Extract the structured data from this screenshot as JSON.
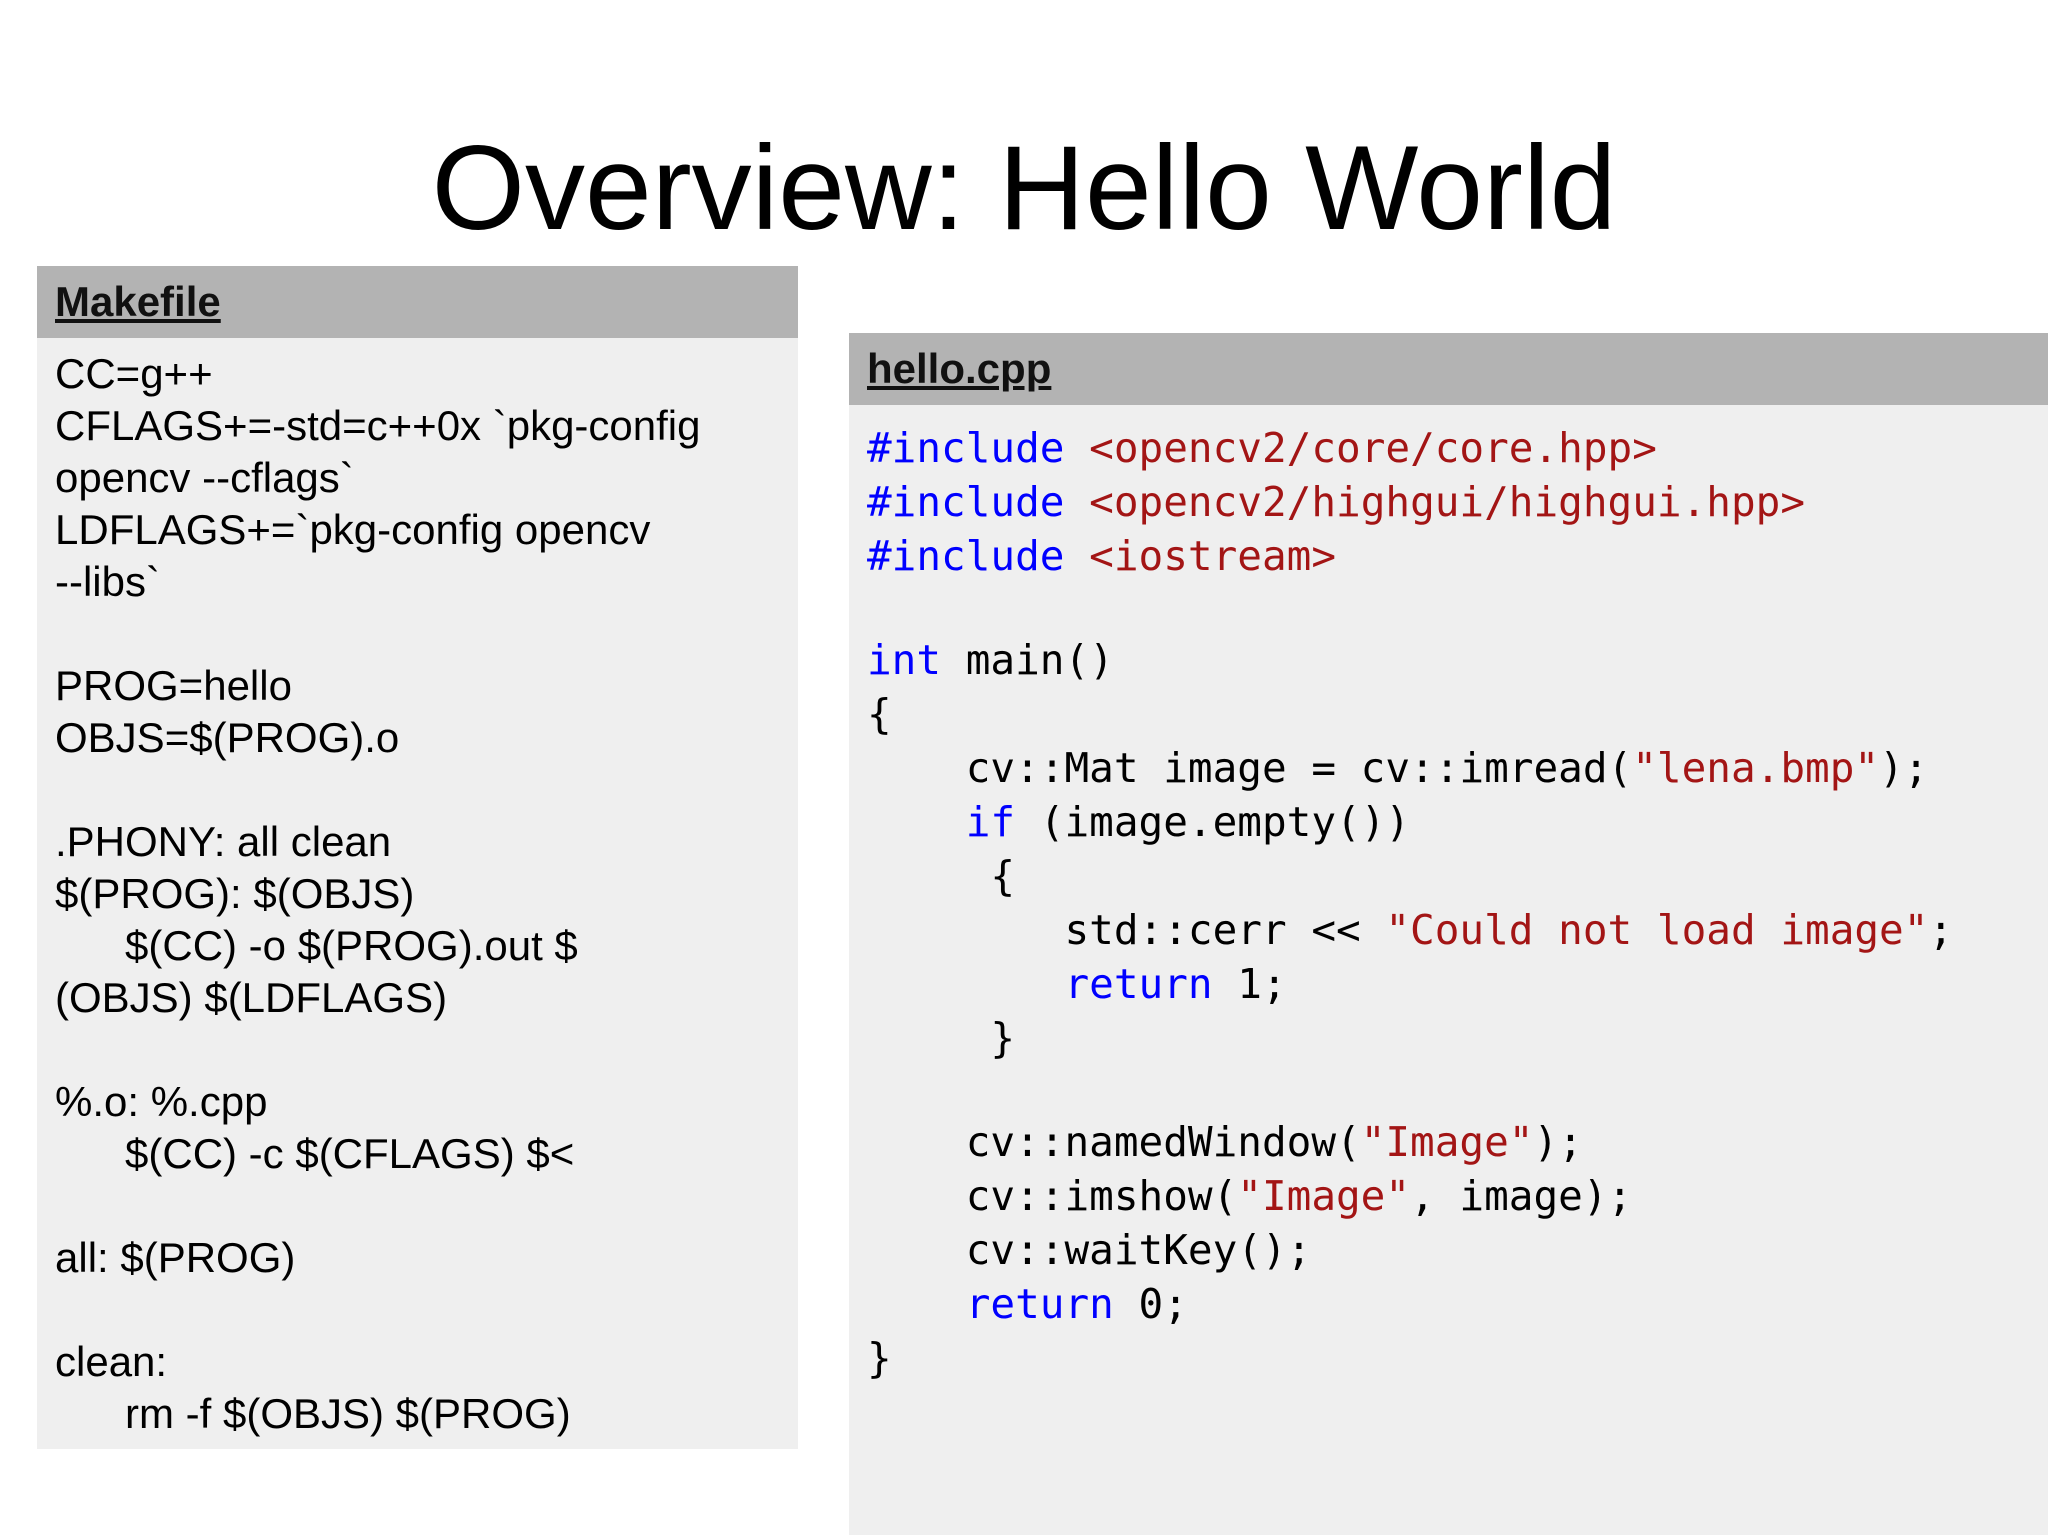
{
  "slide": {
    "title": "Overview: Hello World"
  },
  "makefile": {
    "header": "Makefile",
    "lines": [
      "CC=g++",
      "CFLAGS+=-std=c++0x `pkg-config",
      "opencv --cflags`",
      "LDFLAGS+=`pkg-config opencv",
      "--libs`",
      "",
      "PROG=hello",
      "OBJS=$(PROG).o",
      "",
      ".PHONY: all clean",
      "$(PROG): $(OBJS)",
      "      $(CC) -o $(PROG).out $",
      "(OBJS) $(LDFLAGS)",
      "",
      "%.o: %.cpp",
      "      $(CC) -c $(CFLAGS) $<",
      "",
      "all: $(PROG)",
      "",
      "clean:",
      "      rm -f $(OBJS) $(PROG)"
    ]
  },
  "cpp": {
    "header": "hello.cpp",
    "lines": [
      [
        {
          "t": "#include",
          "c": "kw"
        },
        {
          "t": " ",
          "c": "pl"
        },
        {
          "t": "<opencv2/core/core.hpp>",
          "c": "str"
        }
      ],
      [
        {
          "t": "#include",
          "c": "kw"
        },
        {
          "t": " ",
          "c": "pl"
        },
        {
          "t": "<opencv2/highgui/highgui.hpp>",
          "c": "str"
        }
      ],
      [
        {
          "t": "#include",
          "c": "kw"
        },
        {
          "t": " ",
          "c": "pl"
        },
        {
          "t": "<iostream>",
          "c": "str"
        }
      ],
      [],
      [
        {
          "t": "int",
          "c": "kw"
        },
        {
          "t": " main()",
          "c": "pl"
        }
      ],
      [
        {
          "t": "{",
          "c": "pl"
        }
      ],
      [
        {
          "t": "    cv::Mat image = cv::imread(",
          "c": "pl"
        },
        {
          "t": "\"lena.bmp\"",
          "c": "str"
        },
        {
          "t": ");",
          "c": "pl"
        }
      ],
      [
        {
          "t": "    ",
          "c": "pl"
        },
        {
          "t": "if",
          "c": "kw"
        },
        {
          "t": " (image.empty())",
          "c": "pl"
        }
      ],
      [
        {
          "t": "     {",
          "c": "pl"
        }
      ],
      [
        {
          "t": "        std::cerr << ",
          "c": "pl"
        },
        {
          "t": "\"Could not load image\"",
          "c": "str"
        },
        {
          "t": ";",
          "c": "pl"
        }
      ],
      [
        {
          "t": "        ",
          "c": "pl"
        },
        {
          "t": "return",
          "c": "kw"
        },
        {
          "t": " 1;",
          "c": "pl"
        }
      ],
      [
        {
          "t": "     }",
          "c": "pl"
        }
      ],
      [],
      [
        {
          "t": "    cv::namedWindow(",
          "c": "pl"
        },
        {
          "t": "\"Image\"",
          "c": "str"
        },
        {
          "t": ");",
          "c": "pl"
        }
      ],
      [
        {
          "t": "    cv::imshow(",
          "c": "pl"
        },
        {
          "t": "\"Image\"",
          "c": "str"
        },
        {
          "t": ", image);",
          "c": "pl"
        }
      ],
      [
        {
          "t": "    cv::waitKey();",
          "c": "pl"
        }
      ],
      [
        {
          "t": "    ",
          "c": "pl"
        },
        {
          "t": "return",
          "c": "kw"
        },
        {
          "t": " 0;",
          "c": "pl"
        }
      ],
      [
        {
          "t": "}",
          "c": "pl"
        }
      ]
    ]
  },
  "colors": {
    "keyword": "#0000ff",
    "string": "#a31515",
    "panel_background": "#efefef",
    "panel_header": "#b3b3b3"
  }
}
